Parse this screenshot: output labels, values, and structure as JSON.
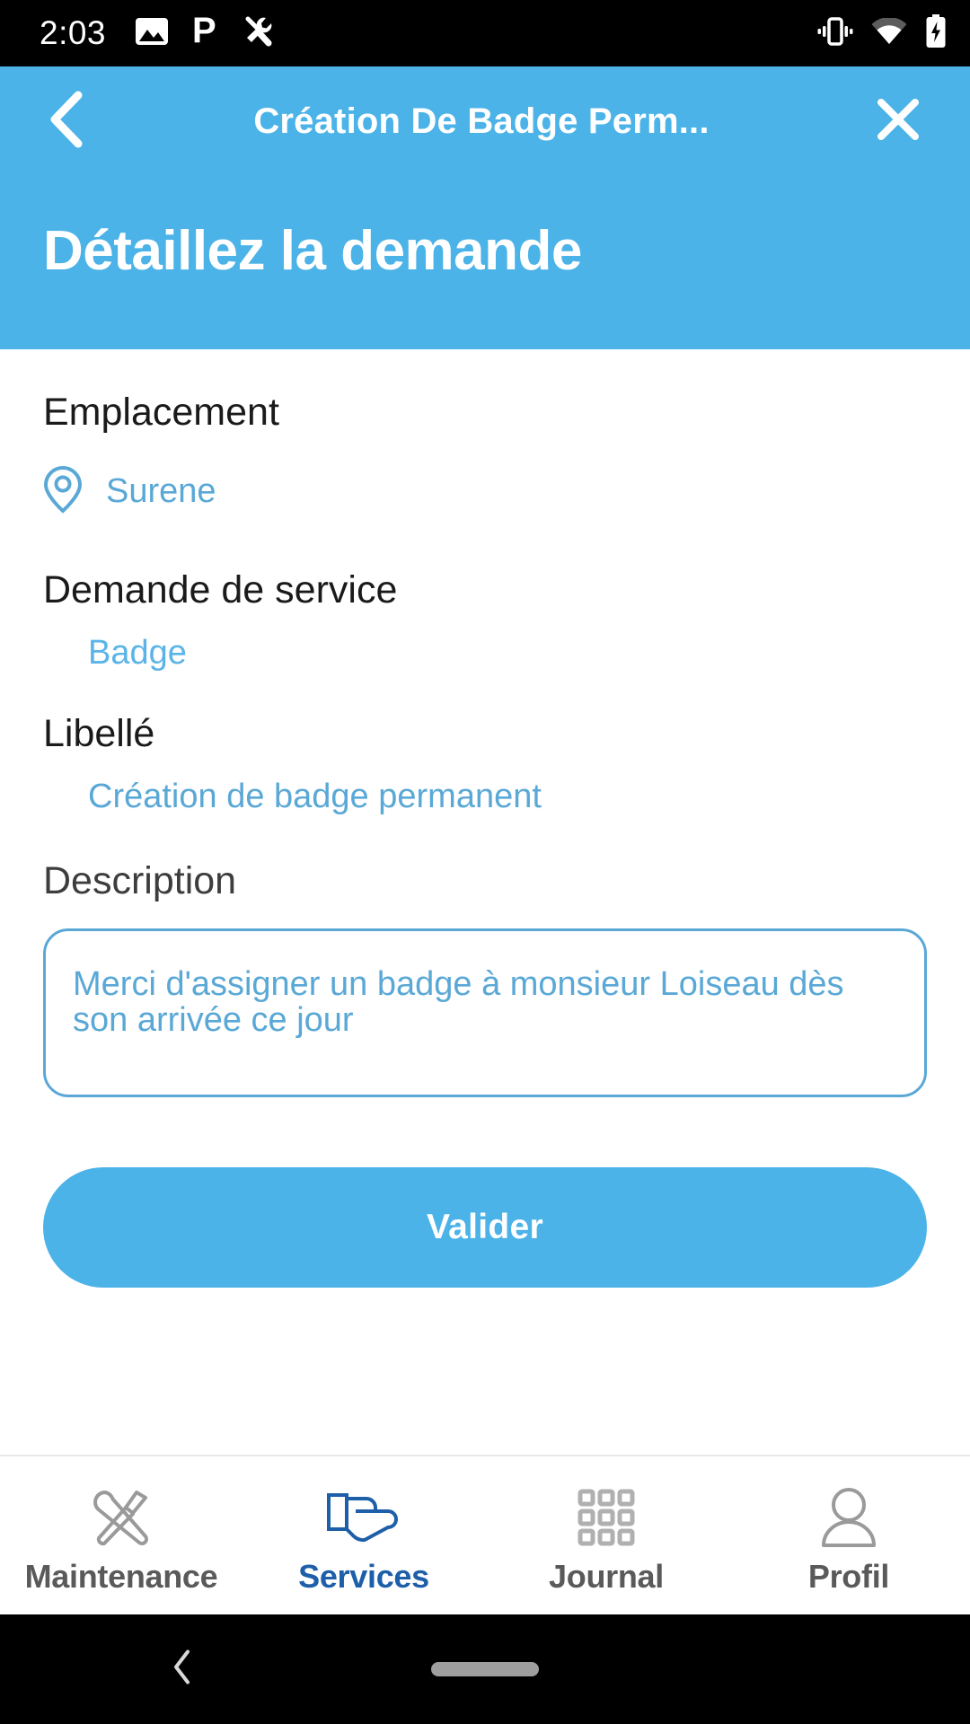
{
  "status_bar": {
    "time": "2:03",
    "left_icons": [
      "image-icon",
      "p-app-icon",
      "tools-icon"
    ],
    "right_icons": [
      "vibrate-icon",
      "wifi-icon",
      "battery-charging-icon"
    ]
  },
  "header": {
    "back_icon": "chevron-left-icon",
    "title": "Création De Badge Perm...",
    "close_icon": "close-icon",
    "page_title": "Détaillez la demande",
    "background_color": "#4bb3e8"
  },
  "form": {
    "emplacement": {
      "label": "Emplacement",
      "icon": "location-pin-icon",
      "value": "Surene"
    },
    "service": {
      "label": "Demande de service",
      "value": "Badge"
    },
    "libelle": {
      "label": "Libellé",
      "value": "Création de badge permanent"
    },
    "description": {
      "label": "Description",
      "value": "Merci d'assigner un badge à monsieur Loiseau dès son arrivée ce jour"
    },
    "submit_label": "Valider"
  },
  "bottom_nav": {
    "active_index": 1,
    "active_color": "#1d5fa8",
    "inactive_color": "#5a5a5a",
    "items": [
      {
        "label": "Maintenance",
        "icon": "tools-icon"
      },
      {
        "label": "Services",
        "icon": "hand-service-icon"
      },
      {
        "label": "Journal",
        "icon": "grid-icon"
      },
      {
        "label": "Profil",
        "icon": "person-icon"
      }
    ]
  },
  "android_nav": {
    "back_icon": "chevron-left-icon",
    "home_handle": "home-pill-handle"
  },
  "colors": {
    "primary_blue": "#4bb3e8",
    "link_blue": "#5aa8d6",
    "nav_active": "#1d5fa8"
  }
}
